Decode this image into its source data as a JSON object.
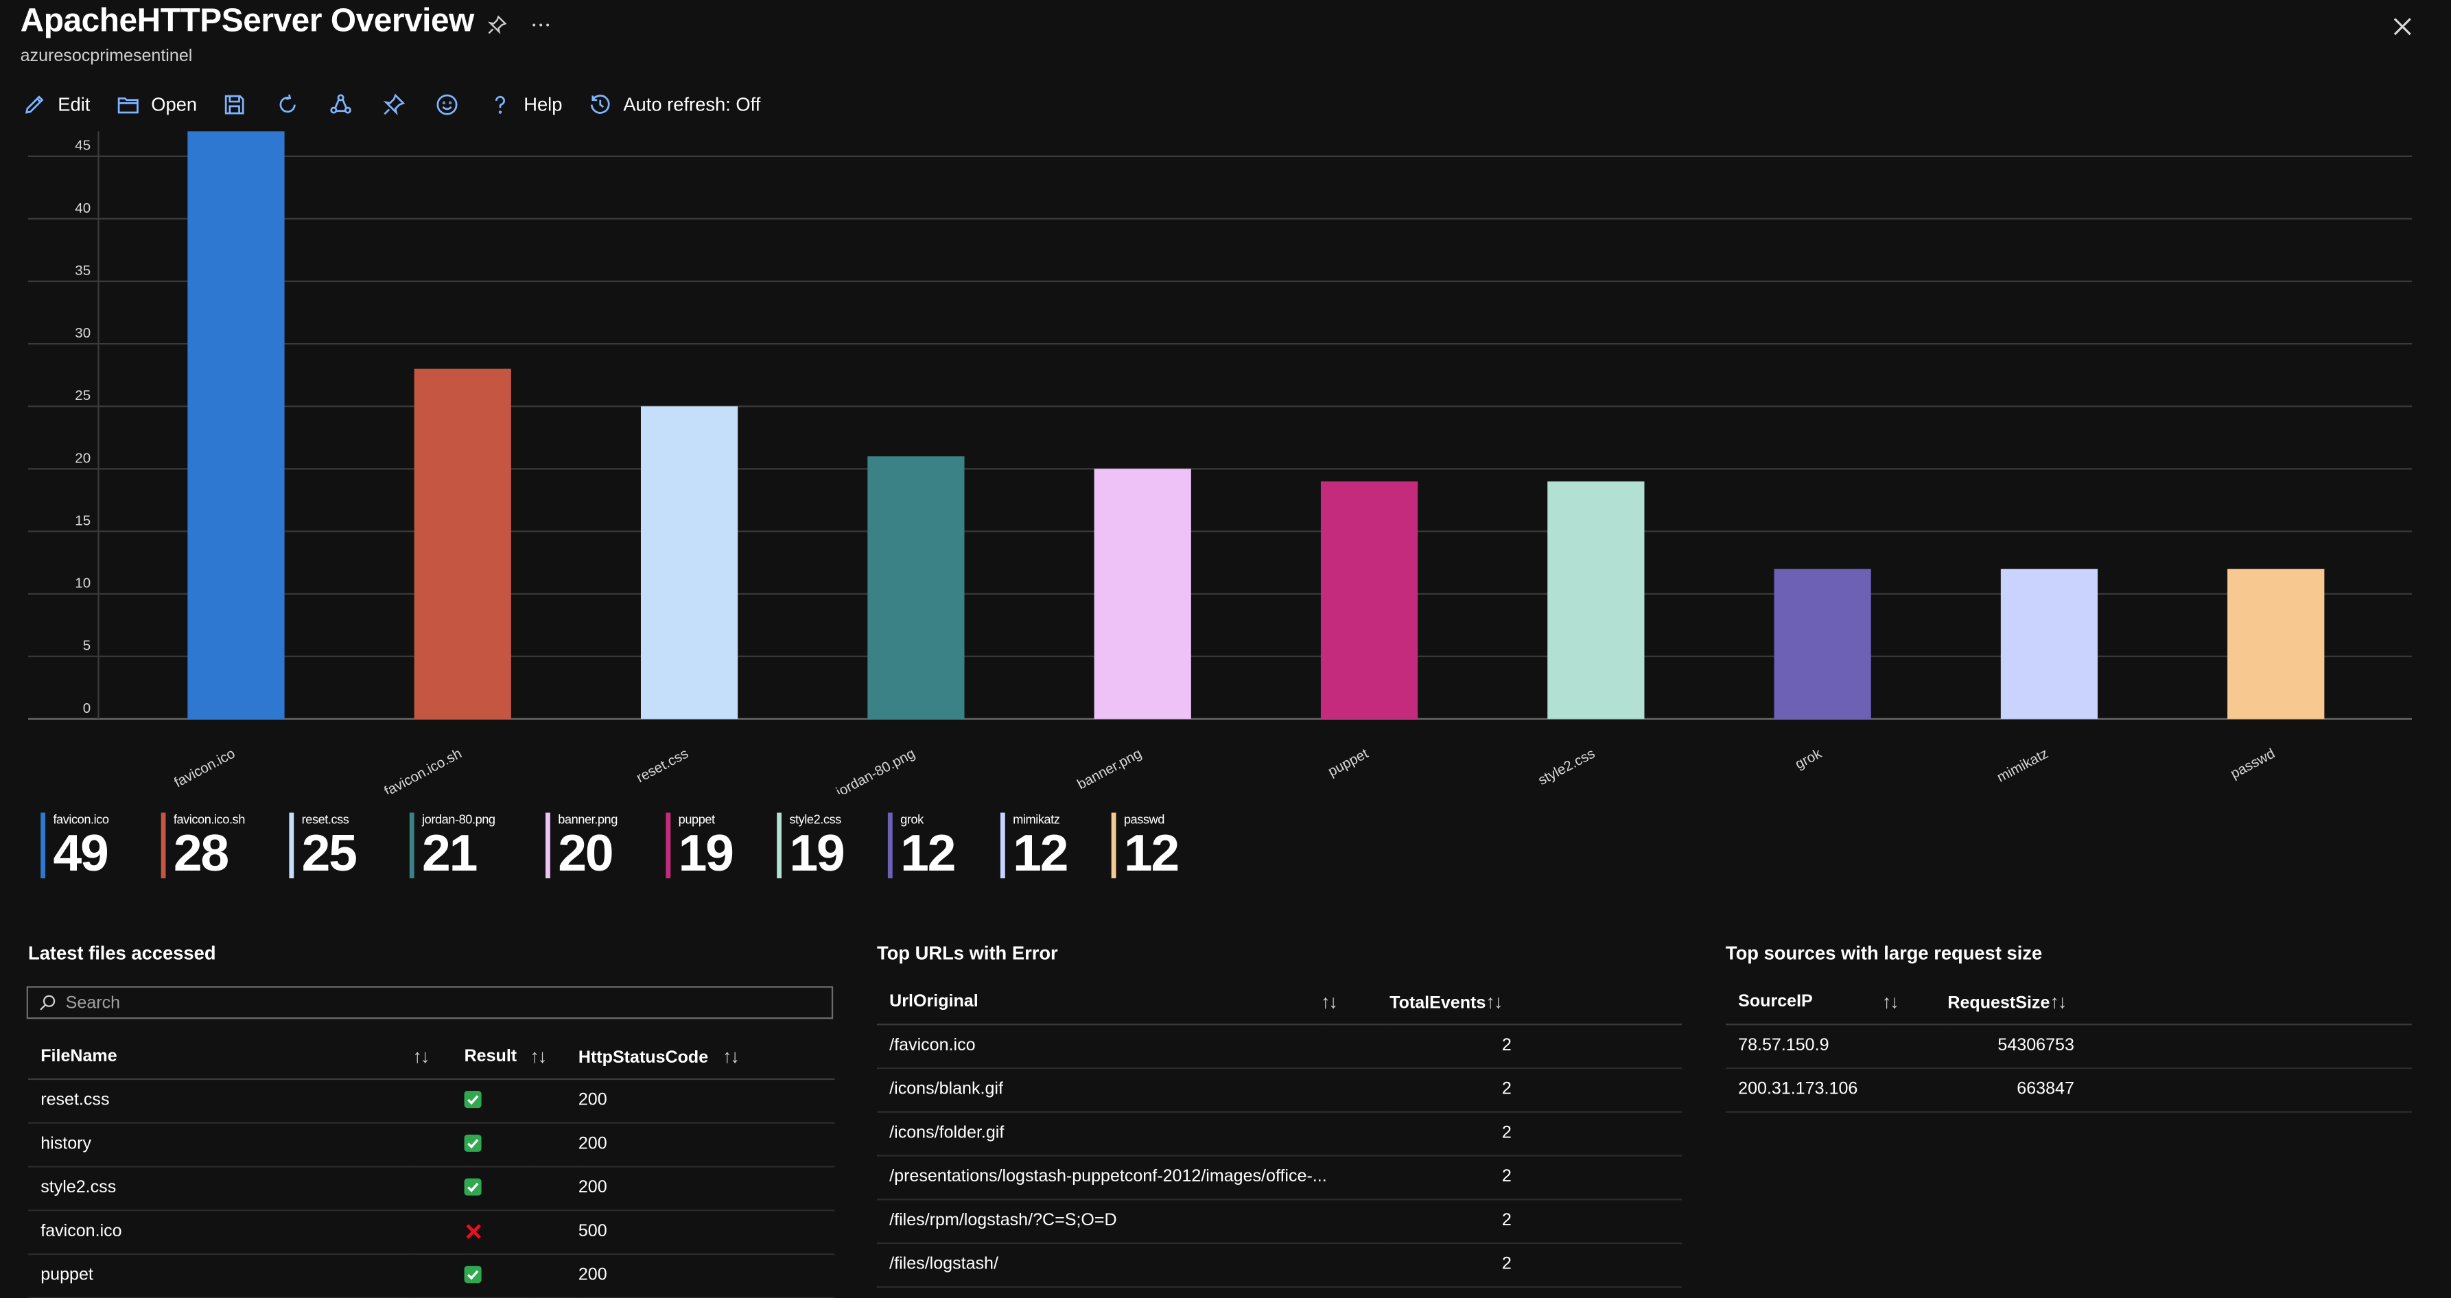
{
  "header": {
    "title": "ApacheHTTPServer Overview",
    "subtitle": "azuresocprimesentinel",
    "pin_icon": "pin-icon",
    "more_icon": "ellipsis-icon",
    "close_icon": "close-icon"
  },
  "toolbar": {
    "edit_label": "Edit",
    "open_label": "Open",
    "help_label": "Help",
    "autorefresh_label": "Auto refresh: Off"
  },
  "chart_data": {
    "type": "bar",
    "categories": [
      "favicon.ico",
      "favicon.ico.sh",
      "reset.css",
      "jordan-80.png",
      "banner.png",
      "puppet",
      "style2.css",
      "grok",
      "mimikatz",
      "passwd"
    ],
    "values": [
      49,
      28,
      25,
      21,
      20,
      19,
      19,
      12,
      12,
      12
    ],
    "colors": [
      "#2f78d2",
      "#c45642",
      "#c5dffb",
      "#3a8286",
      "#eec2f6",
      "#c42b7c",
      "#b2e0d3",
      "#6d61b5",
      "#c9d3fd",
      "#f7c991"
    ],
    "yticks": [
      0,
      5,
      10,
      15,
      20,
      25,
      30,
      35,
      40,
      45
    ],
    "ylim": [
      0,
      47
    ],
    "grid": true
  },
  "tiles": [
    {
      "label": "favicon.ico",
      "value": "49",
      "color": "#2f78d2"
    },
    {
      "label": "favicon.ico.sh",
      "value": "28",
      "color": "#c45642"
    },
    {
      "label": "reset.css",
      "value": "25",
      "color": "#c5dffb"
    },
    {
      "label": "jordan-80.png",
      "value": "21",
      "color": "#3a8286"
    },
    {
      "label": "banner.png",
      "value": "20",
      "color": "#eec2f6"
    },
    {
      "label": "puppet",
      "value": "19",
      "color": "#c42b7c"
    },
    {
      "label": "style2.css",
      "value": "19",
      "color": "#b2e0d3"
    },
    {
      "label": "grok",
      "value": "12",
      "color": "#6d61b5"
    },
    {
      "label": "mimikatz",
      "value": "12",
      "color": "#c9d3fd"
    },
    {
      "label": "passwd",
      "value": "12",
      "color": "#f7c991"
    }
  ],
  "latest_files": {
    "title": "Latest files accessed",
    "search_placeholder": "Search",
    "columns": [
      "FileName",
      "Result",
      "HttpStatusCode"
    ],
    "sort_glyph": "↑↓",
    "rows": [
      {
        "file": "reset.css",
        "ok": true,
        "code": "200"
      },
      {
        "file": "history",
        "ok": true,
        "code": "200"
      },
      {
        "file": "style2.css",
        "ok": true,
        "code": "200"
      },
      {
        "file": "favicon.ico",
        "ok": false,
        "code": "500"
      },
      {
        "file": "puppet",
        "ok": true,
        "code": "200"
      }
    ]
  },
  "top_urls": {
    "title": "Top URLs with Error",
    "columns": [
      "UrlOriginal",
      "TotalEvents"
    ],
    "rows": [
      {
        "url": "/favicon.ico",
        "events": "2"
      },
      {
        "url": "/icons/blank.gif",
        "events": "2"
      },
      {
        "url": "/icons/folder.gif",
        "events": "2"
      },
      {
        "url": "/presentations/logstash-puppetconf-2012/images/office-...",
        "events": "2"
      },
      {
        "url": "/files/rpm/logstash/?C=S;O=D",
        "events": "2"
      },
      {
        "url": "/files/logstash/",
        "events": "2"
      }
    ]
  },
  "top_sources": {
    "title": "Top sources with large request size",
    "columns": [
      "SourceIP",
      "RequestSize"
    ],
    "rows": [
      {
        "ip": "78.57.150.9",
        "size": "54306753"
      },
      {
        "ip": "200.31.173.106",
        "size": "663847"
      }
    ]
  }
}
